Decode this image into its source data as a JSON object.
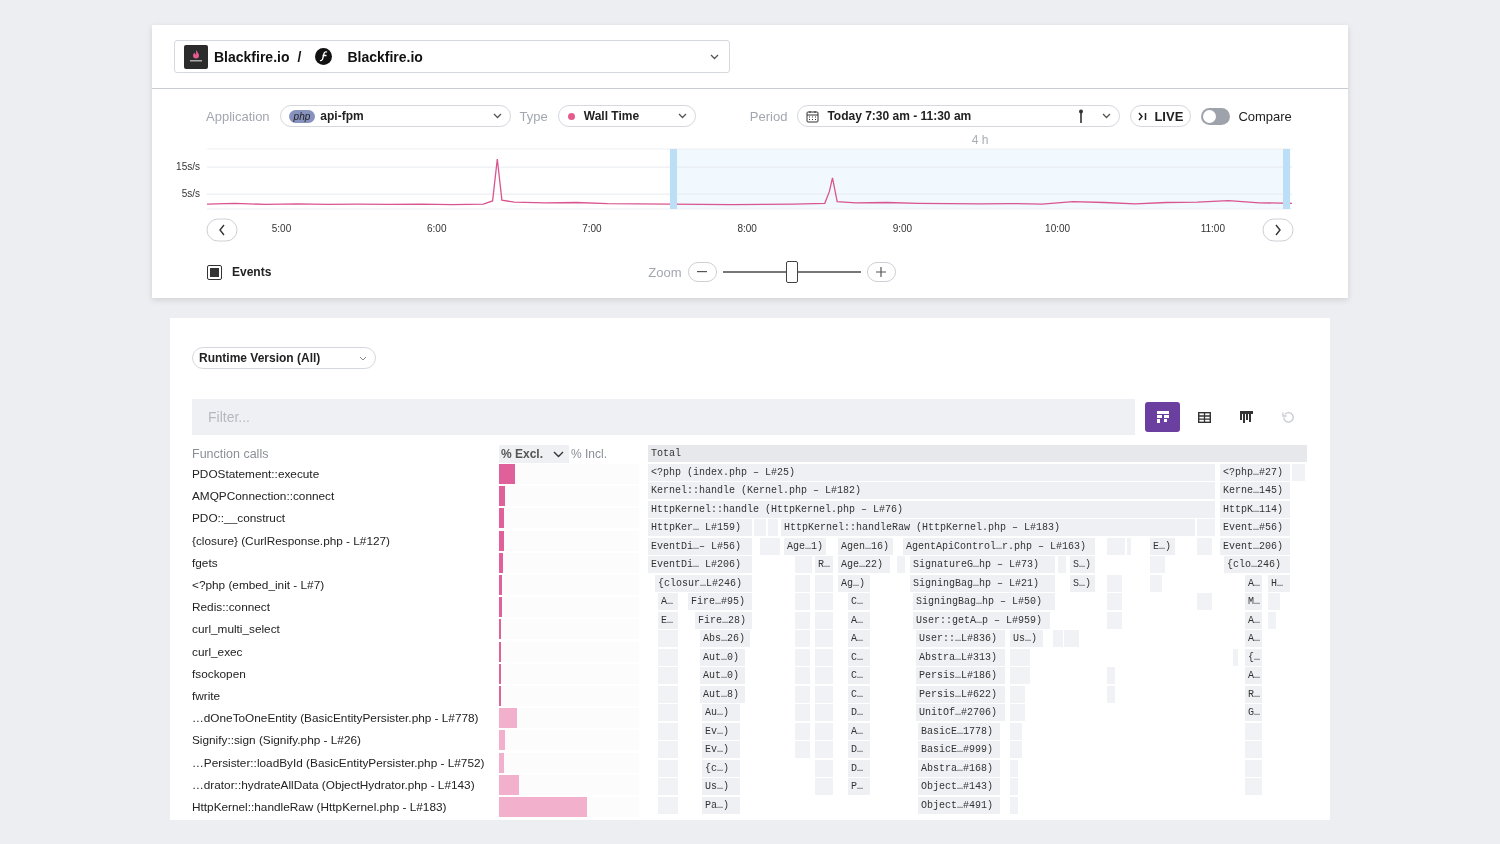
{
  "project_selector": {
    "organization": "Blackfire.io",
    "separator": "/",
    "project": "Blackfire.io"
  },
  "filters": {
    "application": {
      "label": "Application",
      "badge": "php",
      "value": "api-fpm"
    },
    "type": {
      "label": "Type",
      "value": "Wall Time"
    },
    "period": {
      "label": "Period",
      "value": "Today 7:30 am - 11:30 am"
    },
    "live_button": "LIVE",
    "compare": {
      "label": "Compare",
      "on": false
    }
  },
  "chart": {
    "chart_data": {
      "type": "line",
      "x": [
        4.52,
        4.7,
        4.9,
        5.1,
        5.3,
        5.5,
        5.7,
        5.9,
        6.1,
        6.3,
        6.36,
        6.39,
        6.42,
        6.5,
        6.7,
        6.9,
        7.1,
        7.3,
        7.5,
        7.7,
        7.9,
        8.1,
        8.3,
        8.5,
        8.53,
        8.55,
        8.58,
        8.7,
        8.9,
        9.1,
        9.3,
        9.5,
        9.7,
        9.9,
        10.1,
        10.3,
        10.5,
        10.7,
        10.9,
        11.1,
        11.3,
        11.51
      ],
      "series": [
        {
          "color": "#d9558f",
          "values": [
            1.3,
            1.6,
            1.2,
            1.4,
            1.2,
            1.3,
            1.2,
            1.3,
            1.1,
            1.3,
            2.5,
            18,
            2.8,
            2.0,
            1.8,
            1.9,
            1.5,
            1.4,
            1.3,
            1.2,
            1.1,
            1.2,
            1.3,
            1.6,
            6,
            11,
            2.2,
            1.8,
            1.9,
            1.6,
            1.5,
            1.4,
            1.5,
            1.3,
            2.2,
            1.9,
            1.4,
            1.9,
            2.0,
            2.6,
            1.8,
            1.6
          ]
        }
      ],
      "xlim": [
        4.52,
        11.51
      ],
      "ylim": [
        -0.5,
        21.7
      ],
      "xticks": [
        {
          "value": 5,
          "label": "5:00"
        },
        {
          "value": 6,
          "label": "6:00"
        },
        {
          "value": 7,
          "label": "7:00"
        },
        {
          "value": 8,
          "label": "8:00"
        },
        {
          "value": 9,
          "label": "9:00"
        },
        {
          "value": 10,
          "label": "10:00"
        },
        {
          "value": 11,
          "label": "11:00"
        }
      ],
      "yticks": [
        {
          "value": 5,
          "label": "5s/s"
        },
        {
          "value": 15,
          "label": "15s/s"
        }
      ],
      "bands": [
        {
          "axis": "x",
          "from": 7.5,
          "to": 11.5,
          "label": "4 h",
          "color": "#f1f8fe"
        }
      ]
    }
  },
  "events": {
    "label": "Events",
    "checked": true
  },
  "zoom": {
    "label": "Zoom",
    "level": 0.5
  },
  "runtime_select": "Runtime Version (All)",
  "filter": {
    "placeholder": "Filter..."
  },
  "views": [
    {
      "kind": "flame",
      "selected": true
    },
    {
      "kind": "table",
      "selected": false
    },
    {
      "kind": "columns",
      "selected": false
    }
  ],
  "reset": {
    "disabled": true
  },
  "function_calls": {
    "title": "Function calls",
    "sort_columns": [
      {
        "label": "% Excl.",
        "selected": true
      },
      {
        "label": "% Incl.",
        "selected": false
      }
    ],
    "rows": [
      {
        "name": "PDOStatement::execute",
        "level": 0.114,
        "color": "#e0609a"
      },
      {
        "name": "AMQPConnection::connect",
        "level": 0.043,
        "color": "#e0609a"
      },
      {
        "name": "PDO::__construct",
        "level": 0.036,
        "color": "#e0609a"
      },
      {
        "name": "{closure} (CurlResponse.php - L#127)",
        "level": 0.036,
        "color": "#e0609a"
      },
      {
        "name": "fgets",
        "level": 0.029,
        "color": "#e0609a"
      },
      {
        "name": "<?php (embed_init - L#7)",
        "level": 0.021,
        "color": "#e0609a"
      },
      {
        "name": "Redis::connect",
        "level": 0.021,
        "color": "#e0609a"
      },
      {
        "name": "curl_multi_select",
        "level": 0.014,
        "color": "#e0609a"
      },
      {
        "name": "curl_exec",
        "level": 0.014,
        "color": "#e0609a"
      },
      {
        "name": "fsockopen",
        "level": 0.011,
        "color": "#e0609a"
      },
      {
        "name": "fwrite",
        "level": 0.011,
        "color": "#e0609a"
      },
      {
        "name": "…dOneToOneEntity (BasicEntityPersister.php - L#778)",
        "level": 0.129,
        "color": "#f2b0cc"
      },
      {
        "name": "Signify::sign (Signify.php - L#26)",
        "level": 0.043,
        "color": "#f2b0cc"
      },
      {
        "name": "…Persister::loadById (BasicEntityPersister.php - L#752)",
        "level": 0.036,
        "color": "#f2b0cc"
      },
      {
        "name": "…drator::hydrateAllData (ObjectHydrator.php - L#143)",
        "level": 0.143,
        "color": "#f2b0cc"
      },
      {
        "name": "HttpKernel::handleRaw (HttpKernel.php - L#183)",
        "level": 0.629,
        "color": "#f2b0cc"
      }
    ]
  },
  "flame_graph": {
    "levels": [
      {
        "frames": [
          {
            "label": "Total"
          }
        ]
      },
      {
        "frames": [
          {
            "label": "<?php (index.php – L#25)"
          },
          {
            "label": "<?php…#27)"
          }
        ]
      },
      {
        "frames": [
          {
            "label": "Kernel::handle (Kernel.php – L#182)"
          },
          {
            "label": "Kerne…145)"
          }
        ]
      },
      {
        "frames": [
          {
            "label": "HttpKernel::handle (HttpKernel.php – L#76)"
          },
          {
            "label": "HttpK…114)"
          }
        ]
      },
      {
        "frames": [
          {
            "label": "HttpKer… L#159)"
          },
          {
            "label": "HttpKernel::handleRaw (HttpKernel.php – L#183)"
          },
          {
            "label": "Event…#56)"
          }
        ]
      },
      {
        "frames": [
          {
            "label": "EventDi…– L#56)"
          },
          {
            "label": "Age…1)"
          },
          {
            "label": "Agen…16)"
          },
          {
            "label": "AgentApiControl…r.php – L#163)"
          },
          {
            "label": "E…)"
          },
          {
            "label": "Event…206)"
          }
        ]
      },
      {
        "frames": [
          {
            "label": "EventDi… L#206)"
          },
          {
            "label": "R…"
          },
          {
            "label": "Age…22)"
          },
          {
            "label": "SignatureG…hp – L#73)"
          },
          {
            "label": "S…)"
          },
          {
            "label": "{clo…246)"
          }
        ]
      },
      {
        "frames": [
          {
            "label": "{closur…L#246)"
          },
          {
            "label": "Ag…)"
          },
          {
            "label": "SigningBag…hp – L#21)"
          },
          {
            "label": "S…)"
          },
          {
            "label": "A…"
          },
          {
            "label": "H…"
          }
        ]
      },
      {
        "frames": [
          {
            "label": "A…"
          },
          {
            "label": "Fire…#95)"
          },
          {
            "label": "C…"
          },
          {
            "label": "SigningBag…hp – L#50)"
          },
          {
            "label": "M…"
          }
        ]
      },
      {
        "frames": [
          {
            "label": "E…"
          },
          {
            "label": "Fire…28)"
          },
          {
            "label": "A…"
          },
          {
            "label": "User::getA…p – L#959)"
          },
          {
            "label": "A…"
          }
        ]
      },
      {
        "frames": [
          {
            "label": "Abs…26)"
          },
          {
            "label": "A…"
          },
          {
            "label": "User::…L#836)"
          },
          {
            "label": "Us…)"
          },
          {
            "label": "A…"
          }
        ]
      },
      {
        "frames": [
          {
            "label": "Aut…0)"
          },
          {
            "label": "C…"
          },
          {
            "label": "Abstra…L#313)"
          },
          {
            "label": "{…"
          }
        ]
      },
      {
        "frames": [
          {
            "label": "Aut…0)"
          },
          {
            "label": "C…"
          },
          {
            "label": "Persis…L#186)"
          },
          {
            "label": "A…"
          }
        ]
      },
      {
        "frames": [
          {
            "label": "Aut…8)"
          },
          {
            "label": "C…"
          },
          {
            "label": "Persis…L#622)"
          },
          {
            "label": "R…"
          }
        ]
      },
      {
        "frames": [
          {
            "label": "Au…)"
          },
          {
            "label": "D…"
          },
          {
            "label": "UnitOf…#2706)"
          },
          {
            "label": "G…"
          }
        ]
      },
      {
        "frames": [
          {
            "label": "Ev…)"
          },
          {
            "label": "A…"
          },
          {
            "label": "BasicE…1778)"
          }
        ]
      },
      {
        "frames": [
          {
            "label": "Ev…)"
          },
          {
            "label": "D…"
          },
          {
            "label": "BasicE…#999)"
          }
        ]
      },
      {
        "frames": [
          {
            "label": "{c…)"
          },
          {
            "label": "D…"
          },
          {
            "label": "Abstra…#168)"
          }
        ]
      },
      {
        "frames": [
          {
            "label": "Us…)"
          },
          {
            "label": "P…"
          },
          {
            "label": "Object…#143)"
          }
        ]
      },
      {
        "frames": [
          {
            "label": "Pa…)"
          },
          {
            "label": "Object…#491)"
          }
        ]
      }
    ]
  }
}
